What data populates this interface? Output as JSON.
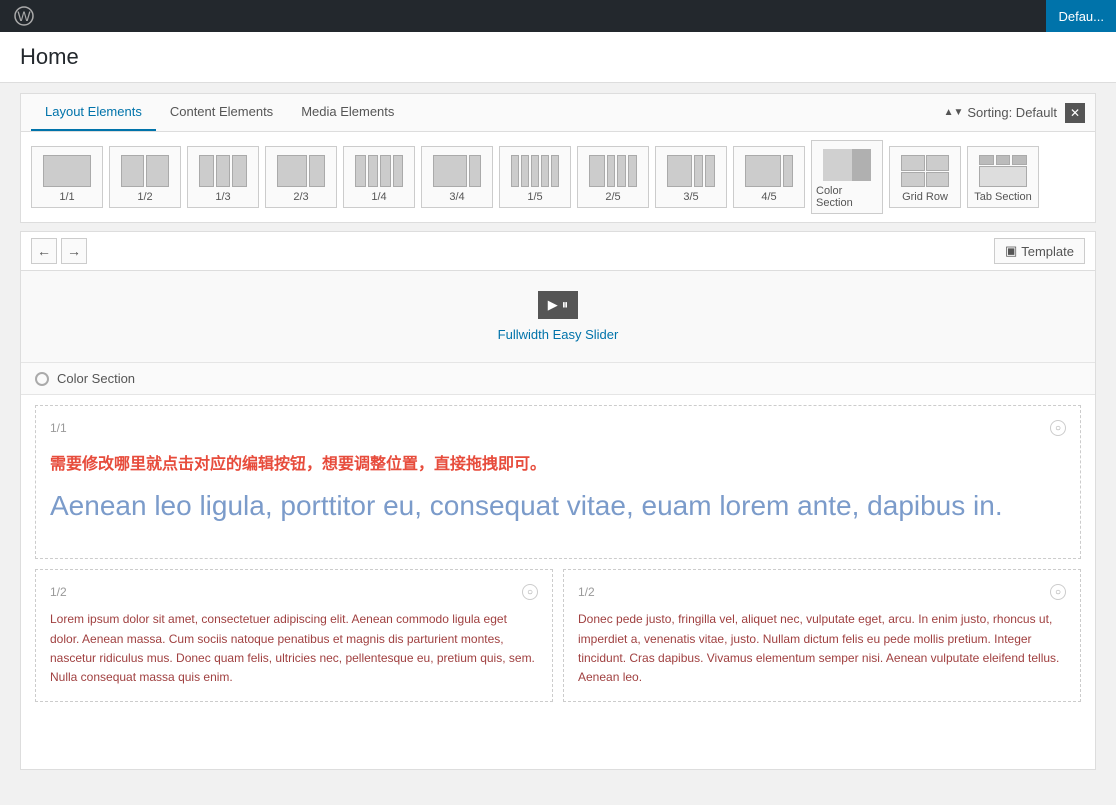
{
  "adminBar": {
    "wpLogo": "✦",
    "defaultBtn": "Defau..."
  },
  "pageTitle": "Home",
  "layoutPanel": {
    "tabs": [
      {
        "label": "Layout Elements",
        "active": true
      },
      {
        "label": "Content Elements",
        "active": false
      },
      {
        "label": "Media Elements",
        "active": false
      }
    ],
    "sorting": "Sorting: Default",
    "gridItems": [
      {
        "label": "1/1",
        "bars": [
          1
        ]
      },
      {
        "label": "1/2",
        "bars": [
          1,
          1
        ]
      },
      {
        "label": "1/3",
        "bars": [
          1,
          1,
          1
        ]
      },
      {
        "label": "2/3",
        "bars": [
          2,
          1
        ]
      },
      {
        "label": "1/4",
        "bars": [
          1,
          1,
          1,
          1
        ]
      },
      {
        "label": "3/4",
        "bars": [
          3,
          1
        ]
      },
      {
        "label": "1/5",
        "bars": [
          1,
          1,
          1,
          1,
          1
        ]
      },
      {
        "label": "2/5",
        "bars": [
          2,
          1,
          1,
          1
        ]
      },
      {
        "label": "3/5",
        "bars": [
          3,
          1,
          1
        ]
      },
      {
        "label": "4/5",
        "bars": [
          4,
          1
        ]
      },
      {
        "label": "Color Section",
        "bars": [
          1
        ]
      },
      {
        "label": "Grid Row",
        "bars": [
          1,
          1
        ]
      },
      {
        "label": "Tab Section",
        "bars": [
          1
        ]
      }
    ]
  },
  "toolbar": {
    "undoLabel": "←",
    "redoLabel": "→",
    "templateLabel": "Template",
    "templateIcon": "▣"
  },
  "slider": {
    "controls": "▶ ⏸",
    "label": "Fullwidth Easy Slider"
  },
  "colorSection": {
    "label": "Color Section"
  },
  "fullCol": {
    "label": "1/1",
    "noticeText": "需要修改哪里就点击对应的编辑按钮，想要调整位置，直接拖拽即可。",
    "bigText": "Aenean leo ligula, porttitor eu, consequat vitae, euam lorem ante, dapibus in."
  },
  "halfCol1": {
    "label": "1/2",
    "text": "Lorem ipsum dolor sit amet, consectetuer adipiscing elit. Aenean commodo ligula eget dolor. Aenean massa. Cum sociis natoque penatibus et magnis dis parturient montes, nascetur ridiculus mus. Donec quam felis, ultricies nec, pellentesque eu, pretium quis, sem. Nulla consequat massa quis enim."
  },
  "halfCol2": {
    "label": "1/2",
    "text": "Donec pede justo, fringilla vel, aliquet nec, vulputate eget, arcu. In enim justo, rhoncus ut, imperdiet a, venenatis vitae, justo. Nullam dictum felis eu pede mollis pretium. Integer tincidunt. Cras dapibus. Vivamus elementum semper nisi. Aenean vulputate eleifend tellus. Aenean leo."
  }
}
